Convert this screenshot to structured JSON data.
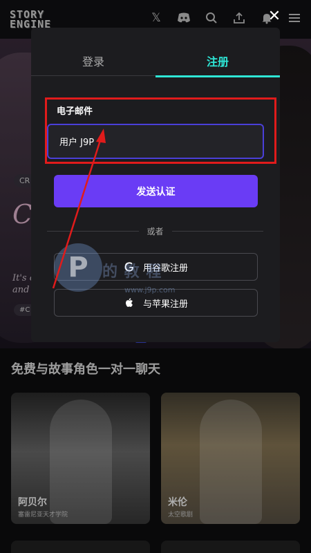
{
  "app": {
    "logo_text": "STORY\nENGINE"
  },
  "topbar": {
    "icons": [
      "x-icon",
      "discord-icon",
      "search-icon",
      "upload-icon",
      "bell-icon",
      "menu-icon"
    ]
  },
  "hero": {
    "tag": "CR",
    "big_text": "C",
    "desc_line1": "It's c",
    "desc_line2": "and",
    "chip": "#C"
  },
  "section": {
    "title": "免费与故事角色一对一聊天"
  },
  "cards": [
    {
      "name": "阿贝尔",
      "subtitle": "塞雷尼亚天才学院"
    },
    {
      "name": "米伦",
      "subtitle": "太空歌剧"
    }
  ],
  "modal": {
    "close_symbol": "✕",
    "tabs": [
      {
        "label": "登录",
        "active": false
      },
      {
        "label": "注册",
        "active": true
      }
    ],
    "email_label": "电子邮件",
    "email_value": "用户 J9P",
    "send_button": "发送认证",
    "or_text": "或者",
    "google_button": "用谷歌注册",
    "apple_button": "与苹果注册"
  },
  "watermark": {
    "text": "的 教 程",
    "url": "www.j9p.com"
  },
  "colors": {
    "accent_teal": "#2ee6d6",
    "primary_purple": "#6a3cf5",
    "highlight_red": "#e01b1b",
    "modal_bg": "#1c1c1f"
  }
}
